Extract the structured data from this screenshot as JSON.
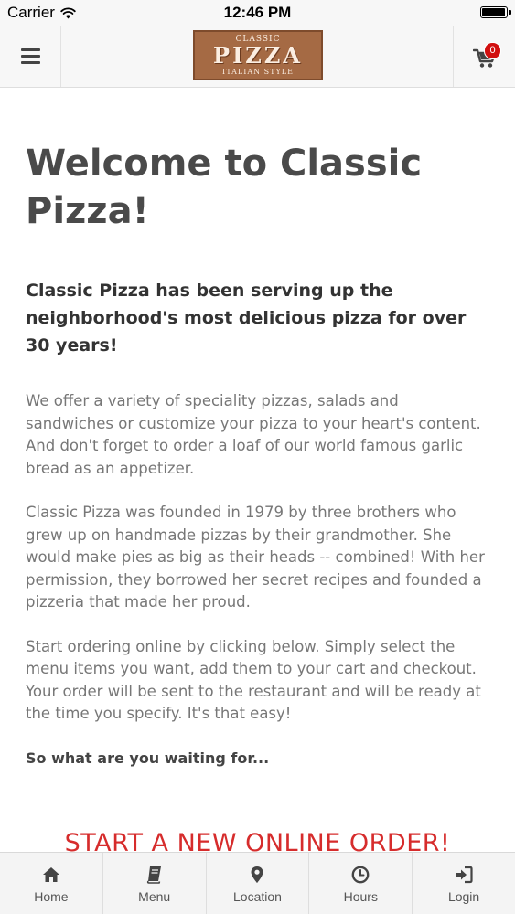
{
  "status_bar": {
    "carrier": "Carrier",
    "time": "12:46 PM",
    "battery_percent": 95
  },
  "header": {
    "logo": {
      "top_text": "CLASSIC",
      "main_text": "PIZZA",
      "bottom_text": "ITALIAN STYLE"
    },
    "cart_count": "0",
    "icons": {
      "menu": "hamburger-menu-icon",
      "cart": "shopping-cart-icon"
    }
  },
  "content": {
    "title": "Welcome to Classic Pizza!",
    "lead": "Classic Pizza has been serving up the neighborhood's most delicious pizza for over 30 years!",
    "paragraph_1": "We offer a variety of speciality pizzas, salads and sandwiches or customize your pizza to your heart's content. And don't forget to order a loaf of our world famous garlic bread as an appetizer.",
    "paragraph_2": "Classic Pizza was founded in 1979 by three brothers who grew up on handmade pizzas by their grandmother. She would make pies as big as their heads -- combined! With her permission, they borrowed her secret recipes and founded a pizzeria that made her proud.",
    "paragraph_3": "Start ordering online by clicking below. Simply select the menu items you want, add them to your cart and checkout. Your order will be sent to the restaurant and will be ready at the time you specify. It's that easy!",
    "cta_question": "So what are you waiting for...",
    "cta_link": "START A NEW ONLINE ORDER!"
  },
  "tabs": [
    {
      "label": "Home",
      "icon": "home-icon"
    },
    {
      "label": "Menu",
      "icon": "book-icon"
    },
    {
      "label": "Location",
      "icon": "map-marker-icon"
    },
    {
      "label": "Hours",
      "icon": "clock-icon"
    },
    {
      "label": "Login",
      "icon": "sign-in-icon"
    }
  ],
  "colors": {
    "accent_red": "#d62c2c",
    "badge_red": "#d10f0f",
    "logo_brown": "#a56a44",
    "title_gray": "#4a4a4a",
    "body_gray": "#777777"
  }
}
